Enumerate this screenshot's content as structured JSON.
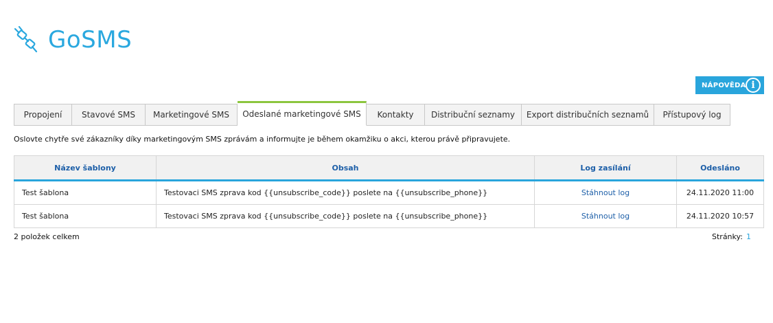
{
  "app": {
    "title": "GoSMS",
    "logo_icon": "plug-connector-icon",
    "accent": "#29a5dc",
    "tab_active_color": "#8cc63e"
  },
  "help_button": {
    "label": "NÁPOVĚDA",
    "icon": "info-icon",
    "icon_glyph": "i"
  },
  "tabs": [
    {
      "label": "Propojení",
      "active": false
    },
    {
      "label": "Stavové SMS",
      "active": false
    },
    {
      "label": "Marketingové SMS",
      "active": false
    },
    {
      "label": "Odeslané marketingové SMS",
      "active": true
    },
    {
      "label": "Kontakty",
      "active": false
    },
    {
      "label": "Distribuční seznamy",
      "active": false
    },
    {
      "label": "Export distribučních seznamů",
      "active": false
    },
    {
      "label": "Přístupový log",
      "active": false
    }
  ],
  "intro_text": "Oslovte chytře své zákazníky díky marketingovým SMS zprávám a informujte je během okamžiku o akci, kterou právě připravujete.",
  "table": {
    "columns": [
      "Název šablony",
      "Obsah",
      "Log zasílání",
      "Odesláno"
    ],
    "rows": [
      {
        "name": "Test šablona",
        "content": "Testovaci SMS zprava kod {{unsubscribe_code}} poslete na {{unsubscribe_phone}}",
        "log_link": "Stáhnout log",
        "sent": "24.11.2020 11:00"
      },
      {
        "name": "Test šablona",
        "content": "Testovaci SMS zprava kod {{unsubscribe_code}} poslete na {{unsubscribe_phone}}",
        "log_link": "Stáhnout log",
        "sent": "24.11.2020 10:57"
      }
    ]
  },
  "footer": {
    "total_text": "2 položek celkem",
    "pages_label": "Stránky:",
    "current_page": "1"
  }
}
